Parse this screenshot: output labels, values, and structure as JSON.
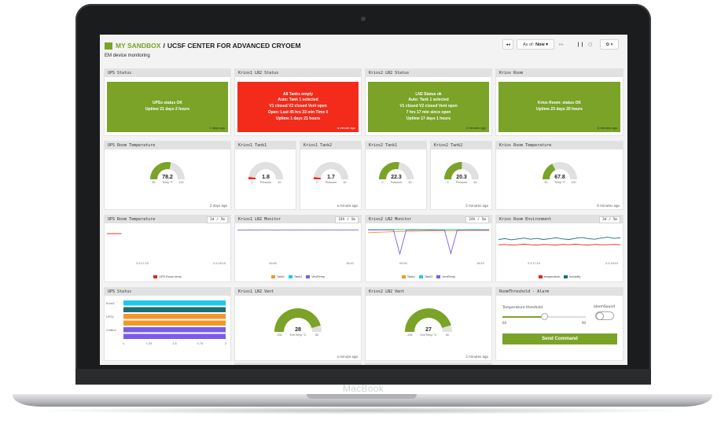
{
  "laptop": {
    "brand": "MacBook"
  },
  "header": {
    "root": "MY SANDBOX",
    "separator": "/",
    "page": "UCSF CENTER FOR ADVANCED CRYOEM",
    "subtitle": "EM device monitoring"
  },
  "toolbar": {
    "back": "◂◂",
    "asof_label": "As of:",
    "asof_value": "Now ▾",
    "forward": "▸▸",
    "pause": "❙❙",
    "refresh": "○",
    "settings": "✿ ▾"
  },
  "colors": {
    "green": "#7aa327",
    "red": "#f22b1b",
    "teal": "#1a6e75",
    "cyan": "#1ec8e6",
    "orange": "#f4962a",
    "purple": "#7b5ce6"
  },
  "status_widgets": [
    {
      "title": "UPS Status",
      "lines": [
        "UPSs status OK",
        "Uptime 21 days 2 hours"
      ],
      "ago": "2 days ago"
    },
    {
      "title": "Krios1 LN2 Status",
      "lines": [
        "All Tanks empty",
        "Auto: Tank 1 selected",
        "V1 closed V2 closed Vent open",
        "Open: Last 45 hrs 33 min Time 0",
        "Uptime 1 days 21 hours"
      ],
      "ago": "a minute ago"
    },
    {
      "title": "Krios2 LN2 Status",
      "lines": [
        "LN2 Status ok",
        "Auto: Tank 1 selected",
        "V1 closed V2 closed Vent open",
        "7 hrs 17 min since open",
        "Uptime 17 days 1 hours"
      ],
      "ago": "2 minutes ago"
    },
    {
      "title": "Krios Room",
      "lines": [
        "Krios Room: status OK",
        "Uptime 23 days 20 hours"
      ],
      "ago": "6 minutes ago"
    }
  ],
  "gauges": [
    {
      "title": "UPS Room Temperature",
      "value": 78.2,
      "display": "78.2",
      "unit": "Temp °F",
      "min": 50,
      "max": 100,
      "min_label": "50",
      "max_label": "100",
      "ago": "2 days ago"
    },
    {
      "title": "Krios1 Tank1",
      "value": 1.8,
      "display": "1.8",
      "unit": "Pressure",
      "min": 0,
      "max": 40,
      "min_label": "0",
      "max_label": "40",
      "ago": ""
    },
    {
      "title": "Krios1 Tank2",
      "value": 1.7,
      "display": "1.7",
      "unit": "Pressure",
      "min": 0,
      "max": 40,
      "min_label": "0",
      "max_label": "40",
      "ago": "a minute ago"
    },
    {
      "title": "Krios2 Tank1",
      "value": 22.3,
      "display": "22.3",
      "unit": "Pressure",
      "min": 0,
      "max": 40,
      "min_label": "0",
      "max_label": "40",
      "ago": ""
    },
    {
      "title": "Krios2 Tank2",
      "value": 20.3,
      "display": "20.3",
      "unit": "Pressure",
      "min": 0,
      "max": 40,
      "min_label": "0",
      "max_label": "40",
      "ago": "2 minutes ago"
    },
    {
      "title": "Krios Room Temperature",
      "value": 67.8,
      "display": "67.8",
      "unit": "Temp °F",
      "min": 50,
      "max": 100,
      "min_label": "50",
      "max_label": "100",
      "ago": "6 minutes ago"
    }
  ],
  "vent_gauges": [
    {
      "title": "Krios1 LN2 Vent",
      "value": 28,
      "display": "28",
      "unit": "Exit Temp °C",
      "min": -200,
      "max": 50,
      "min_label": "-200",
      "max_label": "50",
      "ago": "a minute ago"
    },
    {
      "title": "Krios2 LN2 Vent",
      "value": 27,
      "display": "27",
      "unit": "Exit Temp °C",
      "min": -200,
      "max": 50,
      "min_label": "-200",
      "max_label": "50",
      "ago": "2 minutes ago"
    }
  ],
  "chart_data": [
    {
      "type": "line",
      "title": "UPS Room Temperature",
      "range_label": "3d / 5m",
      "x_ticks": [
        "2-3 17:10",
        "2-3 16:10"
      ],
      "series": [
        {
          "name": "UPS Room temp",
          "color": "#e0261c",
          "values": [
            78.2,
            78.6,
            77.9,
            78.7,
            77.8,
            78.6,
            77.9,
            78.5,
            78.0,
            78.4
          ]
        }
      ],
      "x_coverage": 0.12,
      "ylim": [
        0,
        100
      ]
    },
    {
      "type": "line",
      "title": "Krios1 LN2 Monitor",
      "range_label": "24h / 5m",
      "x_ticks": [
        "00:00",
        "16:10"
      ],
      "series": [
        {
          "name": "Tank1",
          "color": "#f4962a",
          "values": []
        },
        {
          "name": "Tank2",
          "color": "#1ec8e6",
          "values": []
        },
        {
          "name": "VentTemp",
          "color": "#7b5ce6",
          "values": [
            27,
            27,
            28,
            27,
            28,
            28,
            27,
            28,
            28,
            27,
            28,
            28,
            28,
            27,
            28,
            28,
            27,
            28,
            28,
            28
          ]
        }
      ],
      "ylim": [
        -200,
        50
      ]
    },
    {
      "type": "line",
      "title": "Krios2 LN2 Monitor",
      "range_label": "24h / 5m",
      "x_ticks": [
        "00:00",
        "16:10"
      ],
      "series": [
        {
          "name": "Tank1",
          "color": "#f4962a",
          "values": [
            4,
            6,
            8,
            10,
            12,
            14,
            15,
            16,
            17,
            18,
            19,
            20,
            20,
            21,
            21,
            22,
            22,
            22,
            22,
            22
          ]
        },
        {
          "name": "Tank2",
          "color": "#1ec8e6",
          "values": [
            30,
            31,
            29,
            30,
            31,
            30,
            29,
            31,
            30,
            30,
            31,
            29,
            30,
            31,
            30,
            29,
            30,
            31,
            30,
            30
          ]
        },
        {
          "name": "VentTemp",
          "color": "#7b5ce6",
          "values": [
            27,
            27,
            27,
            27,
            27,
            -180,
            26,
            27,
            27,
            27,
            27,
            27,
            27,
            -175,
            26,
            27,
            27,
            27,
            27,
            27
          ]
        }
      ],
      "ylim": [
        -200,
        50
      ]
    },
    {
      "type": "line",
      "title": "Krios Room Environment",
      "range_label": "3d / 5m",
      "x_ticks": [
        "2-3 17:10",
        "2-3 16:10"
      ],
      "series": [
        {
          "name": "temperature",
          "color": "#e0261c",
          "values": [
            40,
            41,
            39,
            40,
            42,
            40,
            39,
            41,
            40,
            39,
            41,
            40,
            42,
            40,
            39,
            41,
            40,
            40,
            41,
            40
          ]
        },
        {
          "name": "humidity",
          "color": "#1a6e75",
          "values": [
            58,
            61,
            57,
            60,
            63,
            59,
            62,
            58,
            61,
            64,
            60,
            58,
            62,
            65,
            61,
            59,
            63,
            66,
            62,
            64
          ]
        }
      ],
      "ylim": [
        0,
        100
      ]
    },
    {
      "type": "bar",
      "title": "UPS Status",
      "categories": [
        "Krios1",
        "",
        "UPS2",
        "",
        "Chillers",
        ""
      ],
      "colors": [
        "#1ec8e6",
        "#1a6e75",
        "#f4962a",
        "#f4962a",
        "#7b5ce6",
        "#7b5ce6"
      ],
      "values": [
        2,
        2,
        2,
        2,
        2,
        2
      ],
      "x_ticks": [
        "1",
        "1.25",
        "1.5",
        "1.75",
        "2"
      ],
      "xlim": [
        1,
        2
      ]
    }
  ],
  "alarm": {
    "title": "RoomThreshold - Alarm",
    "slider_label": "Temperature threshold",
    "slider_min": "60",
    "slider_max": "90",
    "slider_value": 75,
    "slider_min_value": 60,
    "slider_max_value": 90,
    "toggle_label": "alarmSound",
    "toggle_on": false,
    "button": "Send Command"
  }
}
